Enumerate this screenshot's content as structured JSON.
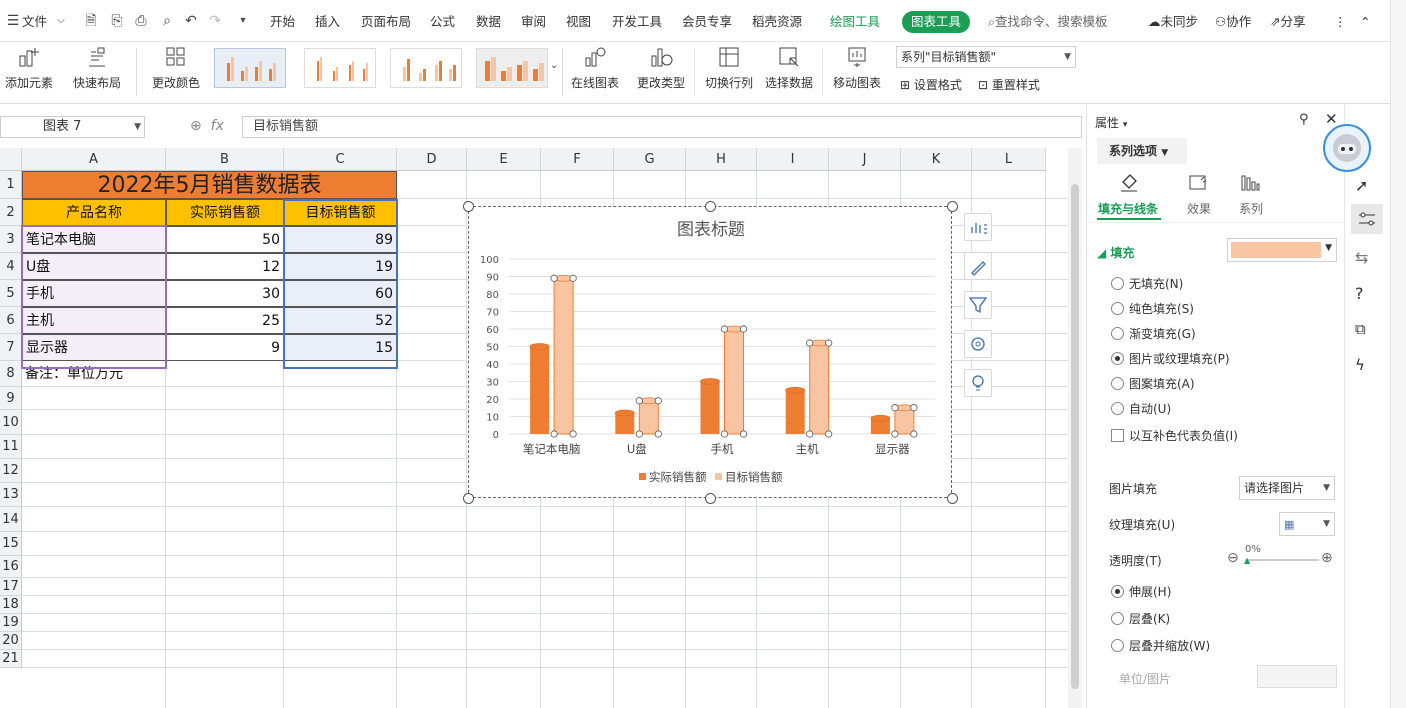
{
  "menubar": {
    "file": "文件",
    "tabs": [
      "开始",
      "插入",
      "页面布局",
      "公式",
      "数据",
      "审阅",
      "视图",
      "开发工具",
      "会员专享",
      "稻壳资源"
    ],
    "drawing_tools": "绘图工具",
    "chart_tools": "图表工具",
    "search_placeholder": "查找命令、搜索模板",
    "sync": "未同步",
    "collab": "协作",
    "share": "分享"
  },
  "ribbon": {
    "add_element": "添加元素",
    "quick_layout": "快速布局",
    "change_color": "更改颜色",
    "online_chart": "在线图表",
    "change_type": "更改类型",
    "switch_row_col": "切换行列",
    "select_data": "选择数据",
    "move_chart": "移动图表",
    "series_selector": "系列\"目标销售额\"",
    "set_format": "设置格式",
    "reset_style": "重置样式"
  },
  "formula": {
    "name_box": "图表 7",
    "fx": "fx",
    "content": "目标销售额"
  },
  "sheet": {
    "columns": [
      "A",
      "B",
      "C",
      "D",
      "E",
      "F",
      "G",
      "H",
      "I",
      "J",
      "K",
      "L"
    ],
    "rows": [
      "1",
      "2",
      "3",
      "4",
      "5",
      "6",
      "7",
      "8",
      "9",
      "10",
      "11",
      "12",
      "13",
      "14",
      "15",
      "16",
      "17",
      "18",
      "19",
      "20",
      "21"
    ],
    "title": "2022年5月销售数据表",
    "headers": [
      "产品名称",
      "实际销售额",
      "目标销售额"
    ],
    "data": [
      [
        "笔记本电脑",
        "50",
        "89"
      ],
      [
        "U盘",
        "12",
        "19"
      ],
      [
        "手机",
        "30",
        "60"
      ],
      [
        "主机",
        "25",
        "52"
      ],
      [
        "显示器",
        "9",
        "15"
      ]
    ],
    "note": "备注：单位万元",
    "colors": {
      "title_bg": "#ED7D31",
      "header_bg": "#FFC000",
      "col_a_fill": "#F3EEF8",
      "col_c_fill": "#E9EEF8"
    }
  },
  "chart_data": {
    "type": "bar",
    "title": "图表标题",
    "categories": [
      "笔记本电脑",
      "U盘",
      "手机",
      "主机",
      "显示器"
    ],
    "series": [
      {
        "name": "实际销售额",
        "values": [
          50,
          12,
          30,
          25,
          9
        ],
        "color": "#ED7D31"
      },
      {
        "name": "目标销售额",
        "values": [
          89,
          19,
          60,
          52,
          15
        ],
        "color": "#F8C4A1"
      }
    ],
    "ylim": [
      0,
      100
    ],
    "yticks": [
      0,
      10,
      20,
      30,
      40,
      50,
      60,
      70,
      80,
      90,
      100
    ],
    "grid": true,
    "legend": "bottom",
    "style": "cylinder",
    "selected_series": "目标销售额"
  },
  "panel": {
    "title": "属性",
    "tab": "系列选项",
    "subtabs": [
      "填充与线条",
      "效果",
      "系列"
    ],
    "fill_section": "填充",
    "fill_color": "#F8C4A1",
    "fill_options": [
      "无填充(N)",
      "纯色填充(S)",
      "渐变填充(G)",
      "图片或纹理填充(P)",
      "图案填充(A)",
      "自动(U)"
    ],
    "fill_selected": 3,
    "invert_label": "以互补色代表负值(I)",
    "picture_fill_label": "图片填充",
    "picture_fill_value": "请选择图片",
    "texture_fill_label": "纹理填充(U)",
    "transparency_label": "透明度(T)",
    "transparency_value": "0%",
    "stretch_options": [
      "伸展(H)",
      "层叠(K)",
      "层叠并缩放(W)"
    ],
    "stretch_selected": 0,
    "unit_label": "单位/图片"
  }
}
